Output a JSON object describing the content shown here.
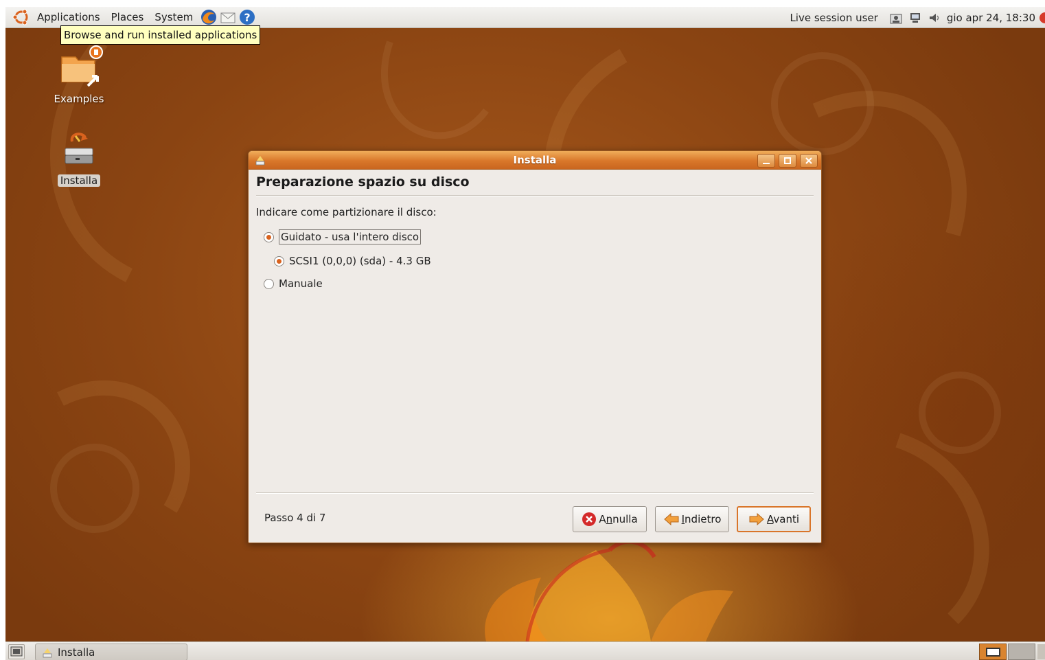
{
  "top_panel": {
    "menus": [
      "Applications",
      "Places",
      "System"
    ],
    "session_user": "Live session user",
    "clock": "gio apr 24, 18:30"
  },
  "tooltip": "Browse and run installed applications",
  "desktop": {
    "icons": [
      {
        "label": "Examples",
        "icon": "folder-link-icon"
      },
      {
        "label": "Installa",
        "icon": "installer-icon"
      }
    ]
  },
  "dialog": {
    "title": "Installa",
    "heading": "Preparazione spazio su disco",
    "prompt": "Indicare come partizionare il disco:",
    "options": [
      {
        "label": "Guidato - usa l'intero disco",
        "checked": true
      },
      {
        "label": "SCSI1 (0,0,0) (sda) - 4.3 GB",
        "checked": true
      },
      {
        "label": "Manuale",
        "checked": false
      }
    ],
    "step": "Passo 4 di 7",
    "buttons": {
      "cancel": {
        "pre": "A",
        "mnemonic": "n",
        "post": "nulla"
      },
      "back": {
        "pre": "",
        "mnemonic": "I",
        "post": "ndietro"
      },
      "next": {
        "pre": "",
        "mnemonic": "A",
        "post": "vanti"
      }
    }
  },
  "bottom_panel": {
    "task": "Installa"
  },
  "colors": {
    "accent": "#d9752a",
    "desktop_brown": "#8a4412",
    "tooltip_bg": "#ffffbf"
  }
}
